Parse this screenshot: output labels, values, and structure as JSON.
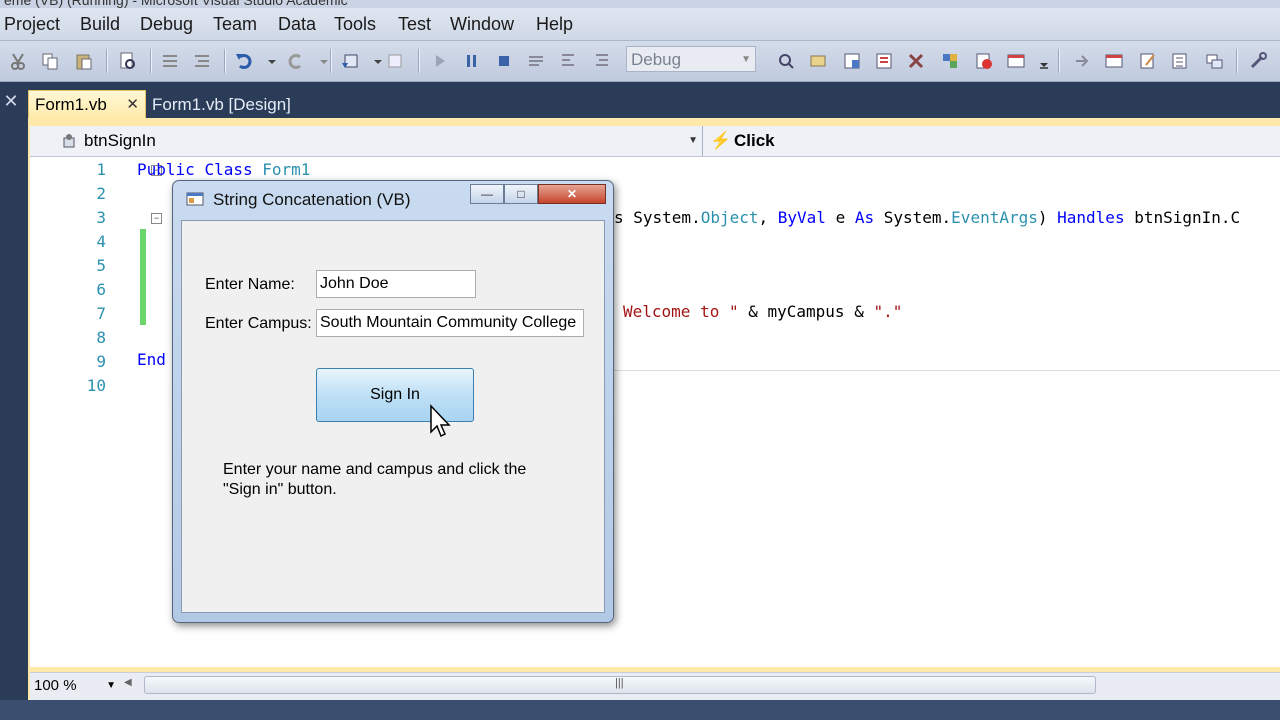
{
  "window": {
    "title_partial": "ême (VB) (Running) - Microsoft Visual Studio Academic"
  },
  "menubar": {
    "items": [
      "Project",
      "Build",
      "Debug",
      "Team",
      "Data",
      "Tools",
      "Test",
      "Window",
      "Help"
    ]
  },
  "toolbar": {
    "configuration": "Debug"
  },
  "tabs": [
    {
      "label": "Form1.vb",
      "active": true
    },
    {
      "label": "Form1.vb [Design]",
      "active": false
    }
  ],
  "navbar": {
    "object": "btnSignIn",
    "event": "Click"
  },
  "editor": {
    "line_numbers": [
      "1",
      "2",
      "3",
      "4",
      "5",
      "6",
      "7",
      "8",
      "9",
      "10"
    ],
    "line1": {
      "kw1": "Public",
      "kw2": "Class",
      "name": "Form1"
    },
    "line3": {
      "tail1": "s System.",
      "type1": "Object",
      "tail2": ", ",
      "kw1": "ByVal",
      "tail3": " e ",
      "kw2": "As",
      "tail4": " System.",
      "type2": "EventArgs",
      "tail5": ") ",
      "kw3": "Handles",
      "tail6": " btnSignIn.C"
    },
    "line7": {
      "str1": "Welcome to \"",
      "tail1": " & myCampus & ",
      "str2": "\".\""
    },
    "line9": {
      "kw1": "End"
    },
    "zoom": "100 %"
  },
  "dialog": {
    "title": "String Concatenation (VB)",
    "name_label": "Enter Name:",
    "name_value": "John Doe",
    "campus_label": "Enter Campus:",
    "campus_value": "South Mountain Community College",
    "button_label": "Sign In",
    "instructions": "Enter your name and campus and click the \"Sign in\" button.",
    "minimize_glyph": "—",
    "maximize_glyph": "□",
    "close_glyph": "✕"
  },
  "colors": {
    "keyword": "#0000ff",
    "type": "#2b91af",
    "string": "#a31515",
    "active_tab": "#ffe9a8",
    "ide_dark": "#2b3c59"
  }
}
